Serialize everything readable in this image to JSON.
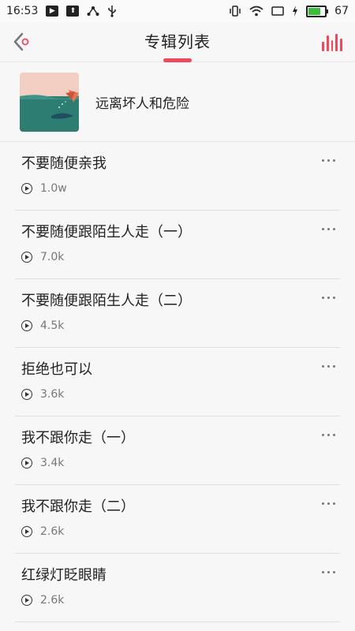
{
  "status_bar": {
    "time": "16:53",
    "battery": "67",
    "icons_left": [
      "play-notification-icon",
      "upload-icon",
      "share-icon",
      "usb-icon"
    ],
    "icons_right": [
      "vibrate-icon",
      "wifi-icon",
      "screen-icon",
      "charging-icon",
      "battery-icon"
    ]
  },
  "header": {
    "title": "专辑列表",
    "accent_color": "#f0475c"
  },
  "album": {
    "name": "远离坏人和危险"
  },
  "tracks": [
    {
      "title": "不要随便亲我",
      "plays": "1.0w"
    },
    {
      "title": "不要随便跟陌生人走（一）",
      "plays": "7.0k"
    },
    {
      "title": "不要随便跟陌生人走（二）",
      "plays": "4.5k"
    },
    {
      "title": "拒绝也可以",
      "plays": "3.6k"
    },
    {
      "title": "我不跟你走（一）",
      "plays": "3.4k"
    },
    {
      "title": "我不跟你走（二）",
      "plays": "2.6k"
    },
    {
      "title": "红绿灯眨眼睛",
      "plays": "2.6k"
    }
  ]
}
